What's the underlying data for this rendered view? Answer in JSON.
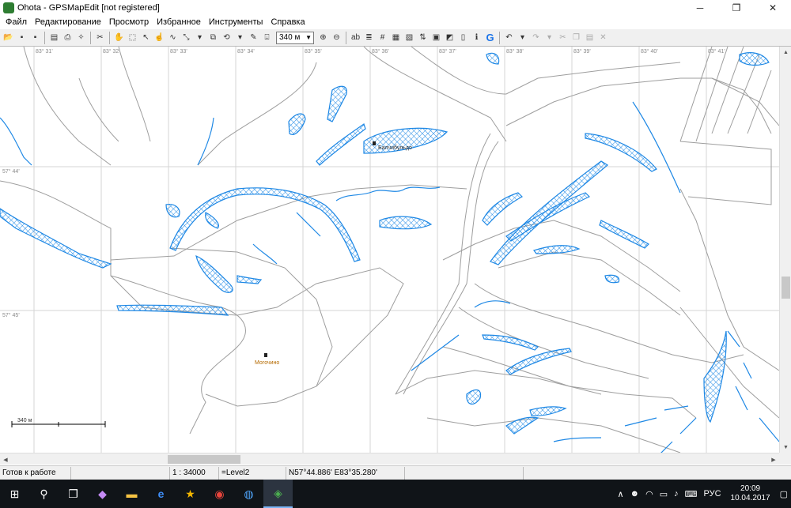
{
  "window": {
    "title": "Ohota - GPSMapEdit [not registered]",
    "buttons": [
      "─",
      "❐",
      "✕"
    ]
  },
  "menu": [
    "Файл",
    "Редактирование",
    "Просмотр",
    "Избранное",
    "Инструменты",
    "Справка"
  ],
  "toolbar": {
    "scale_value": "340 м",
    "text_tool_label": "ab"
  },
  "map": {
    "lon_labels": [
      "83° 31'",
      "83° 32'",
      "83° 33'",
      "83° 34'",
      "83° 35'",
      "83° 36'",
      "83° 37'",
      "83° 38'",
      "83° 39'",
      "83° 40'",
      "83° 41'"
    ],
    "lat_labels": [
      "57° 44'",
      "57° 45'"
    ],
    "places": [
      {
        "name": "Балчибульдо"
      },
      {
        "name": "Могочино"
      }
    ],
    "scale_bar_label": "340 м",
    "colors": {
      "water": "#1e88e5",
      "grid": "#d4d4d4",
      "road": "#9e9e9e"
    }
  },
  "status": {
    "ready": "Готов к работе",
    "scale": "1 : 34000",
    "level": "=Level2",
    "coords": "N57°44.886' E83°35.280'"
  },
  "taskbar": {
    "clock_time": "20:09",
    "clock_date": "10.04.2017",
    "lang": "РУС"
  }
}
